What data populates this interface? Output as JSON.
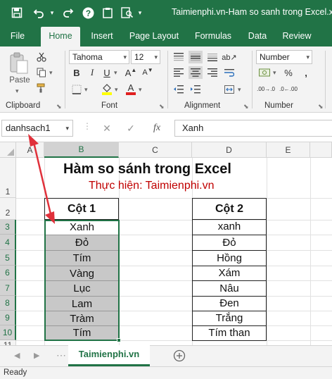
{
  "window": {
    "title": "Taimienphi.vn-Ham so sanh trong Excel.xls",
    "quick_access": [
      "save-icon",
      "undo-icon",
      "redo-icon",
      "help-icon",
      "clipboard-icon",
      "print-preview-icon"
    ]
  },
  "ribbon": {
    "tabs": [
      "File",
      "Home",
      "Insert",
      "Page Layout",
      "Formulas",
      "Data",
      "Review"
    ],
    "active_tab": "Home",
    "clipboard": {
      "label": "Clipboard",
      "paste_label": "Paste"
    },
    "font": {
      "label": "Font",
      "font_name": "Tahoma",
      "font_size": "12",
      "bold": "B",
      "italic": "I",
      "underline": "U"
    },
    "alignment": {
      "label": "Alignment"
    },
    "number": {
      "label": "Number",
      "format": "Number",
      "dec_increase": ".00→.0",
      "dec_decrease": ".0←.00"
    }
  },
  "formula_bar": {
    "name_box": "danhsach1",
    "fx": "fx",
    "value": "Xanh"
  },
  "grid": {
    "columns": [
      "A",
      "B",
      "C",
      "D",
      "E"
    ],
    "rows": [
      "1",
      "2",
      "3",
      "4",
      "5",
      "6",
      "7",
      "8",
      "9",
      "10",
      "11"
    ],
    "selected_column": "B",
    "title": "Hàm so sánh trong Excel",
    "subtitle": "Thực hiện: Taimienphi.vn",
    "col1_header": "Cột 1",
    "col2_header": "Cột 2",
    "col1_values": [
      "Xanh",
      "Đỏ",
      "Tím",
      "Vàng",
      "Lục",
      "Lam",
      "Tràm",
      "Tím"
    ],
    "col2_values": [
      "xanh",
      "Đỏ",
      "Hồng",
      "Xám",
      "Nâu",
      "Đen",
      "Trắng",
      "Tím than"
    ]
  },
  "sheets": {
    "tabs": [
      "Taimienphi.vn"
    ],
    "active": "Taimienphi.vn"
  },
  "status": {
    "text": "Ready"
  },
  "colors": {
    "accent": "#217346",
    "annotation_arrow": "#e0303a",
    "subtitle": "#c00000",
    "selection_fill": "#c8c8c8"
  }
}
